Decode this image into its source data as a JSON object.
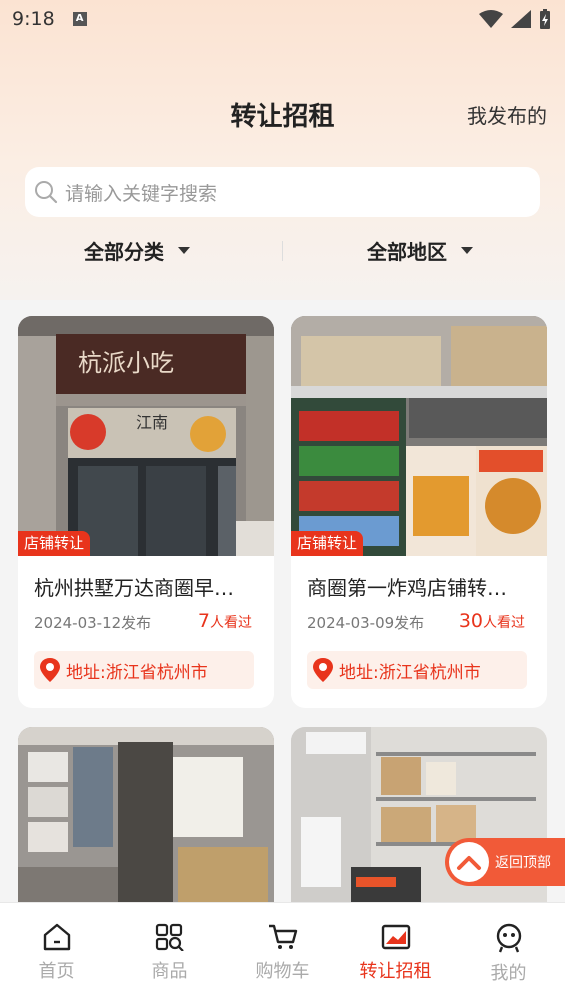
{
  "status_bar": {
    "time": "9:18",
    "notification_icon": "A"
  },
  "header": {
    "title": "转让招租",
    "right_link": "我发布的"
  },
  "search": {
    "placeholder": "请输入关键字搜索"
  },
  "filters": {
    "category": "全部分类",
    "region": "全部地区"
  },
  "listings": [
    {
      "badge": "店铺转让",
      "title": "杭州拱墅万达商圈早…",
      "date": "2024-03-12发布",
      "views_num": "7",
      "views_suffix": "人看过",
      "address": "地址:浙江省杭州市",
      "image": "storefront-photo"
    },
    {
      "badge": "店铺转让",
      "title": "商圈第一炸鸡店铺转…",
      "date": "2024-03-09发布",
      "views_num": "30",
      "views_suffix": "人看过",
      "address": "地址:浙江省杭州市",
      "image": "fried-chicken-shop-photo"
    },
    {
      "image": "kitchen-photo"
    },
    {
      "image": "storage-room-photo"
    }
  ],
  "back_to_top": {
    "label": "返回顶部"
  },
  "tabbar": {
    "items": [
      {
        "label": "首页",
        "icon": "home-icon"
      },
      {
        "label": "商品",
        "icon": "goods-icon"
      },
      {
        "label": "购物车",
        "icon": "cart-icon"
      },
      {
        "label": "转让招租",
        "icon": "transfer-icon",
        "active": true
      },
      {
        "label": "我的",
        "icon": "profile-icon"
      }
    ]
  },
  "colors": {
    "accent": "#e8341c",
    "back_top": "#f15a38",
    "header_bg": "#fbe3d2"
  }
}
